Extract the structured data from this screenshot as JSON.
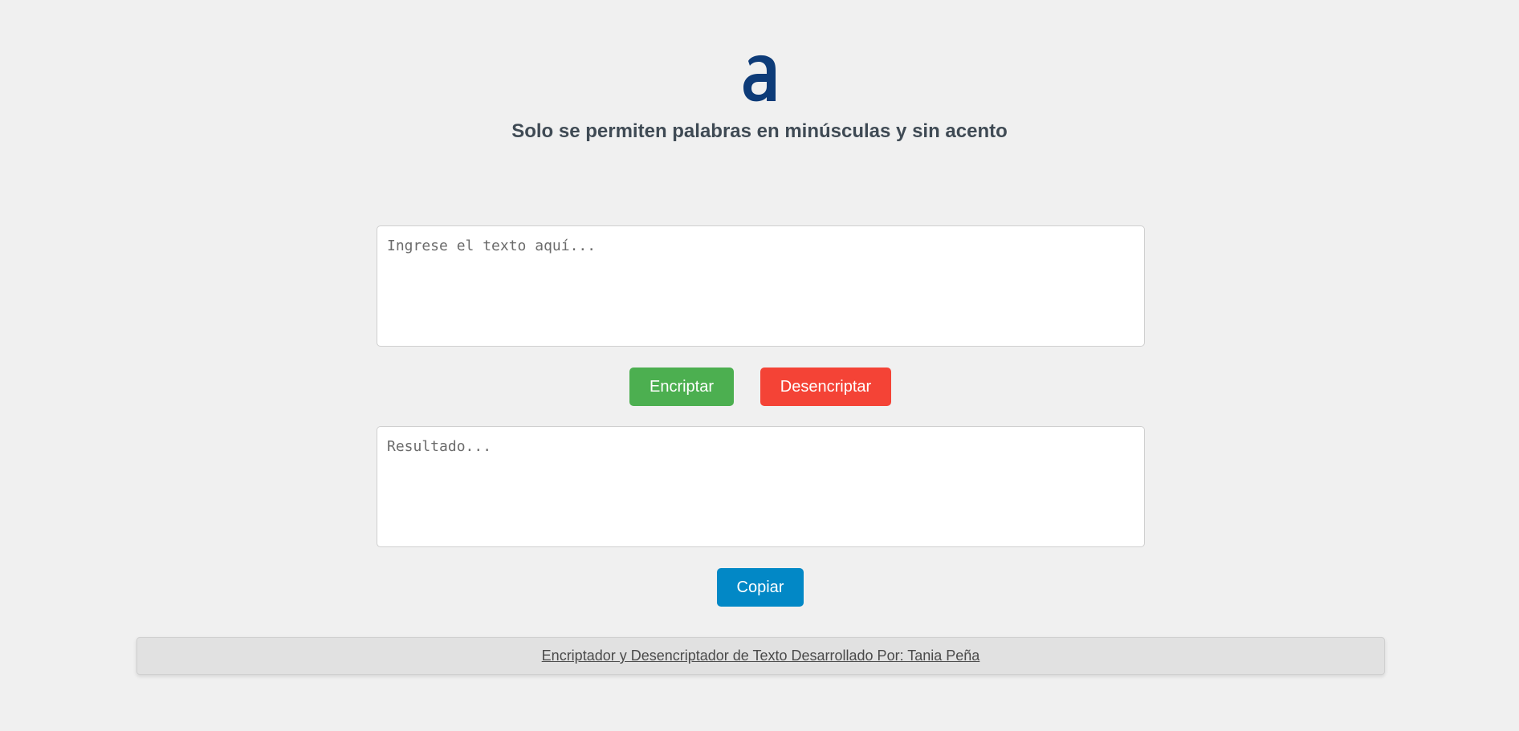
{
  "header": {
    "logo_icon": "alura-a-logo-icon",
    "logo_color": "#0d3b78",
    "subtitle": "Solo se permiten palabras en minúsculas y sin acento"
  },
  "input": {
    "value": "",
    "placeholder": "Ingrese el texto aquí..."
  },
  "actions": {
    "encrypt_label": "Encriptar",
    "decrypt_label": "Desencriptar",
    "encrypt_color": "#4caf50",
    "decrypt_color": "#f44336"
  },
  "output": {
    "value": "",
    "placeholder": "Resultado..."
  },
  "copy": {
    "label": "Copiar",
    "color": "#0288c6"
  },
  "footer": {
    "text": "Encriptador y Desencriptador de Texto Desarrollado Por: Tania Peña"
  }
}
